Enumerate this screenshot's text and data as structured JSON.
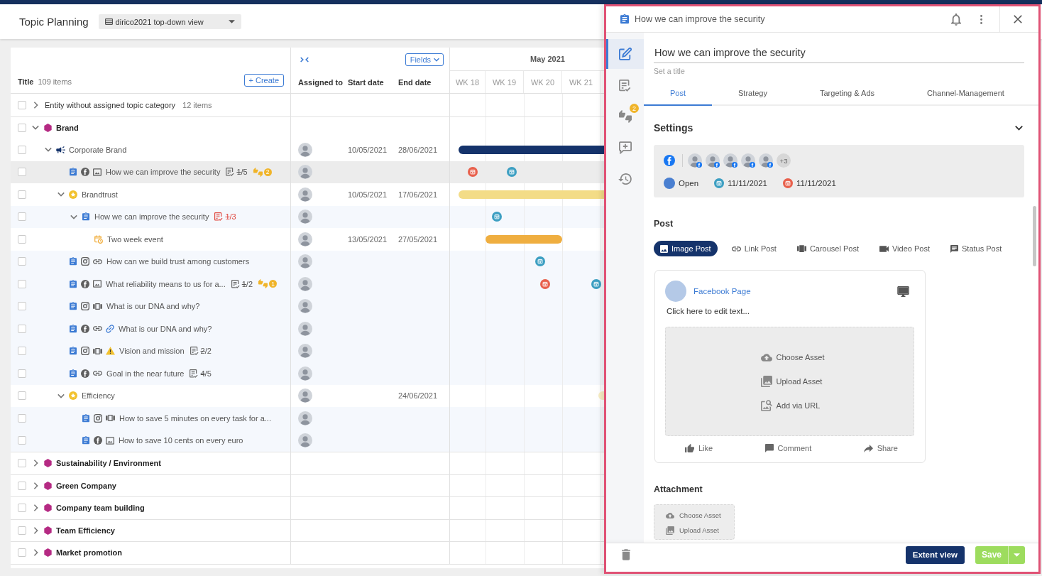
{
  "header": {
    "title": "Topic Planning",
    "view": "dirico2021 top-down view"
  },
  "table": {
    "title_column": {
      "label": "Title",
      "count": "109 items"
    },
    "create_button": "+ Create",
    "fields_button": "Fields",
    "columns": [
      "Assigned to",
      "Start date",
      "End date"
    ],
    "timeline": {
      "month": "May 2021",
      "weeks": [
        "WK 18",
        "WK 19",
        "WK 20",
        "WK 21"
      ]
    },
    "rows": [
      {
        "kind": "group",
        "label": "Entity without assigned topic category",
        "count": "12 items",
        "checked": false,
        "selected": false,
        "expanded": false
      },
      {
        "kind": "category",
        "label": "Brand",
        "checked": false,
        "selected": false,
        "expanded": true,
        "children": [
          {
            "kind": "campaign",
            "label": "Corporate Brand",
            "checked": false,
            "selected": false,
            "expanded": true,
            "avatar": true,
            "start": "10/05/2021",
            "end": "28/06/2021",
            "timeline": [
              {
                "kind": "bar",
                "color": "#15336b"
              }
            ],
            "children": [
              {
                "kind": "post",
                "label": "How we can improve the security",
                "checked": false,
                "selected": true,
                "icons": [
                  {
                    "kind": "facebook"
                  },
                  {
                    "kind": "image"
                  }
                ],
                "avatar": true,
                "checklist": {
                  "done": "1",
                  "of": "/5",
                  "overdue": false
                },
                "approvals": "2",
                "timeline": [
                  {
                    "kind": "marker",
                    "color": "#e8604c"
                  },
                  {
                    "kind": "marker",
                    "color": "#3d9fc2"
                  }
                ]
              },
              {
                "kind": "topic",
                "label": "Brandtrust",
                "checked": false,
                "selected": false,
                "expanded": true,
                "avatar": true,
                "start": "10/05/2021",
                "end": "17/06/2021",
                "timeline": [
                  {
                    "kind": "bar",
                    "color": "#f3dc87"
                  }
                ],
                "children": [
                  {
                    "kind": "post",
                    "label": "How we can improve the security",
                    "checked": false,
                    "selected": false,
                    "expanded": true,
                    "avatar": true,
                    "checklist": {
                      "done": "1",
                      "of": "/3",
                      "overdue": true
                    },
                    "timeline": [
                      {
                        "kind": "marker",
                        "color": "#3d9fc2"
                      }
                    ],
                    "children": [
                      {
                        "kind": "event",
                        "label": "Two week event",
                        "checked": false,
                        "selected": false,
                        "avatar": true,
                        "start": "13/05/2021",
                        "end": "27/05/2021",
                        "timeline": [
                          {
                            "kind": "bar",
                            "color": "#efae40"
                          }
                        ]
                      }
                    ]
                  }
                ]
              },
              {
                "kind": "post",
                "label": "How can we build trust among customers",
                "checked": false,
                "selected": false,
                "icons": [
                  {
                    "kind": "instagram"
                  },
                  {
                    "kind": "link"
                  }
                ],
                "avatar": true,
                "timeline": [
                  {
                    "kind": "marker",
                    "color": "#3d9fc2"
                  }
                ]
              },
              {
                "kind": "post",
                "label": "What reliability means to us for a...",
                "checked": false,
                "selected": false,
                "icons": [
                  {
                    "kind": "facebook"
                  },
                  {
                    "kind": "image"
                  }
                ],
                "avatar": true,
                "checklist": {
                  "done": "1",
                  "of": "/2",
                  "overdue": false
                },
                "approvals": "1",
                "timeline": [
                  {
                    "kind": "marker",
                    "color": "#e8604c"
                  },
                  {
                    "kind": "marker",
                    "color": "#3d9fc2"
                  }
                ]
              },
              {
                "kind": "post",
                "label": "What is our DNA and why?",
                "checked": false,
                "selected": false,
                "icons": [
                  {
                    "kind": "instagram"
                  },
                  {
                    "kind": "carousel"
                  }
                ],
                "avatar": true
              },
              {
                "kind": "post",
                "label": "What is our DNA and why?",
                "checked": false,
                "selected": false,
                "icons": [
                  {
                    "kind": "facebook"
                  },
                  {
                    "kind": "link"
                  },
                  {
                    "kind": "linked"
                  }
                ],
                "avatar": true
              },
              {
                "kind": "post",
                "label": "Vision and mission",
                "checked": false,
                "selected": false,
                "icons": [
                  {
                    "kind": "instagram"
                  },
                  {
                    "kind": "carousel"
                  },
                  {
                    "kind": "warning"
                  }
                ],
                "avatar": true,
                "checklist": {
                  "done": "2",
                  "of": "/2",
                  "overdue": false
                }
              },
              {
                "kind": "post",
                "label": "Goal in the near future",
                "checked": false,
                "selected": false,
                "icons": [
                  {
                    "kind": "facebook"
                  },
                  {
                    "kind": "link"
                  }
                ],
                "avatar": true,
                "checklist": {
                  "done": "4",
                  "of": "/5",
                  "overdue": false
                }
              },
              {
                "kind": "topic",
                "label": "Efficiency",
                "checked": false,
                "selected": false,
                "expanded": true,
                "avatar": true,
                "end": "24/06/2021",
                "timeline": [
                  {
                    "kind": "bar",
                    "color": "#f8eec4"
                  }
                ],
                "children": [
                  {
                    "kind": "post",
                    "label": "How to save 5 minutes on every task for a...",
                    "checked": false,
                    "selected": false,
                    "icons": [
                      {
                        "kind": "instagram"
                      },
                      {
                        "kind": "carousel"
                      }
                    ],
                    "avatar": true
                  },
                  {
                    "kind": "post",
                    "label": "How to save 10 cents on every euro",
                    "checked": false,
                    "selected": false,
                    "icons": [
                      {
                        "kind": "facebook"
                      },
                      {
                        "kind": "image"
                      }
                    ],
                    "avatar": true
                  }
                ]
              }
            ]
          }
        ]
      },
      {
        "kind": "category",
        "label": "Sustainability / Environment",
        "checked": false,
        "selected": false,
        "expanded": false
      },
      {
        "kind": "category",
        "label": "Green Company",
        "checked": false,
        "selected": false,
        "expanded": false
      },
      {
        "kind": "category",
        "label": "Company team building",
        "checked": false,
        "selected": false,
        "expanded": false
      },
      {
        "kind": "category",
        "label": "Team Efficiency",
        "checked": false,
        "selected": false,
        "expanded": false
      },
      {
        "kind": "category",
        "label": "Market promotion",
        "checked": false,
        "selected": false,
        "expanded": false
      }
    ]
  },
  "panel": {
    "title": "How we can improve the security",
    "rail": [
      {
        "kind": "edit",
        "selected": true
      },
      {
        "kind": "checklist",
        "selected": false
      },
      {
        "kind": "approval",
        "selected": false,
        "badge": "2"
      },
      {
        "kind": "comment",
        "selected": false
      },
      {
        "kind": "history",
        "selected": false
      }
    ],
    "title_field": {
      "value": "How we can improve the security",
      "helper": "Set a title"
    },
    "tabs": [
      {
        "label": "Post",
        "selected": true
      },
      {
        "label": "Strategy",
        "selected": false
      },
      {
        "label": "Targeting & Ads",
        "selected": false
      },
      {
        "label": "Channel-Management",
        "selected": false
      }
    ],
    "settings": {
      "heading": "Settings",
      "expanded": true,
      "channel": {
        "kind": "facebook"
      },
      "accounts": [
        {
          "kind": "facebook"
        },
        {
          "kind": "facebook"
        },
        {
          "kind": "facebook"
        },
        {
          "kind": "facebook"
        },
        {
          "kind": "facebook"
        }
      ],
      "more_accounts": "+3",
      "status": {
        "label": "Open",
        "color": "#4a7fd0"
      },
      "dates": [
        {
          "value": "11/11/2021",
          "color": "#3d9fc2"
        },
        {
          "value": "11/11/2021",
          "color": "#e8604c"
        }
      ]
    },
    "post": {
      "heading": "Post",
      "types": [
        {
          "kind": "image",
          "label": "Image Post",
          "selected": true
        },
        {
          "kind": "link",
          "label": "Link Post",
          "selected": false
        },
        {
          "kind": "carousel",
          "label": "Carousel Post",
          "selected": false
        },
        {
          "kind": "video",
          "label": "Video Post",
          "selected": false
        },
        {
          "kind": "status",
          "label": "Status Post",
          "selected": false
        }
      ],
      "preview": {
        "page_name": "Facebook Page",
        "editor": {
          "placeholder": "Click here to edit text..."
        },
        "asset_actions": [
          {
            "kind": "choose",
            "label": "Choose Asset"
          },
          {
            "kind": "upload",
            "label": "Upload Asset"
          },
          {
            "kind": "url",
            "label": "Add via URL"
          }
        ],
        "reactions": [
          {
            "kind": "like",
            "label": "Like"
          },
          {
            "kind": "comment",
            "label": "Comment"
          },
          {
            "kind": "share",
            "label": "Share"
          }
        ]
      }
    },
    "attachment": {
      "heading": "Attachment",
      "actions": [
        {
          "kind": "choose",
          "label": "Choose Asset"
        },
        {
          "kind": "upload",
          "label": "Upload Asset"
        }
      ]
    },
    "footer": {
      "extent_button": "Extent view",
      "save_button": "Save"
    }
  }
}
